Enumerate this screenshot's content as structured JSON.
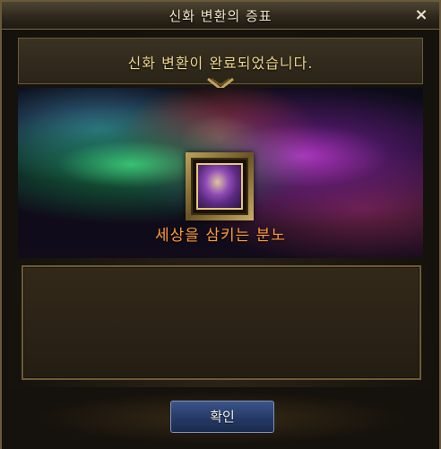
{
  "dialog": {
    "title": "신화 변환의 증표",
    "close_icon": "×"
  },
  "result": {
    "message": "신화 변환이 완료되었습니다."
  },
  "item": {
    "name": "세상을 삼키는 분노",
    "icon": "item-portrait-icon"
  },
  "actions": {
    "confirm_label": "확인"
  },
  "colors": {
    "title_text": "#efe6c7",
    "message_text": "#ecd48a",
    "item_name_text": "#ff9a3a",
    "button_blue": "#253a66"
  }
}
